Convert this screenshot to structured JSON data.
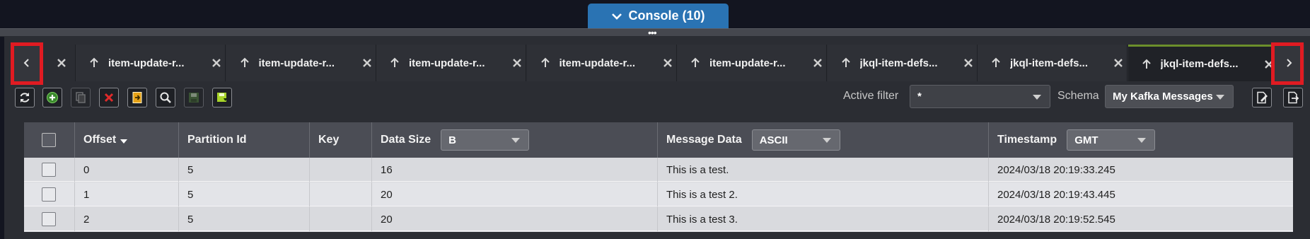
{
  "console": {
    "label": "Console (10)",
    "icon": "chevron-down-icon"
  },
  "tabs": [
    {
      "label": "item-update-r...",
      "icon": "arrow-up-icon",
      "active": false
    },
    {
      "label": "item-update-r...",
      "icon": "arrow-up-icon",
      "active": false
    },
    {
      "label": "item-update-r...",
      "icon": "arrow-up-icon",
      "active": false
    },
    {
      "label": "item-update-r...",
      "icon": "arrow-up-icon",
      "active": false
    },
    {
      "label": "item-update-r...",
      "icon": "arrow-up-icon",
      "active": false
    },
    {
      "label": "jkql-item-defs...",
      "icon": "arrow-up-icon",
      "active": false
    },
    {
      "label": "jkql-item-defs...",
      "icon": "arrow-up-icon",
      "active": false
    },
    {
      "label": "jkql-item-defs...",
      "icon": "arrow-up-icon",
      "active": true
    }
  ],
  "toolbar": {
    "buttons": [
      "refresh-icon",
      "add-icon",
      "copy-icon",
      "delete-icon",
      "import-icon",
      "search-icon",
      "save-icon",
      "export-icon"
    ],
    "active_filter_label": "Active filter",
    "active_filter_value": "*",
    "schema_label": "Schema",
    "schema_value": "My Kafka Messages"
  },
  "table": {
    "columns": {
      "offset": "Offset",
      "partition": "Partition Id",
      "key": "Key",
      "data_size": "Data Size",
      "data_size_unit": "B",
      "message": "Message Data",
      "message_encoding": "ASCII",
      "timestamp": "Timestamp",
      "timezone": "GMT"
    },
    "rows": [
      {
        "offset": "0",
        "partition": "5",
        "key": "",
        "size": "16",
        "message": "This is a test.",
        "timestamp": "2024/03/18 20:19:33.245"
      },
      {
        "offset": "1",
        "partition": "5",
        "key": "",
        "size": "20",
        "message": "This is a test 2.",
        "timestamp": "2024/03/18 20:19:43.445"
      },
      {
        "offset": "2",
        "partition": "5",
        "key": "",
        "size": "20",
        "message": "This is a test 3.",
        "timestamp": "2024/03/18 20:19:52.545"
      }
    ]
  },
  "colors": {
    "accent": "#2a73b3",
    "active_tab_border": "#6c8f2b",
    "highlight": "#e01b22"
  }
}
